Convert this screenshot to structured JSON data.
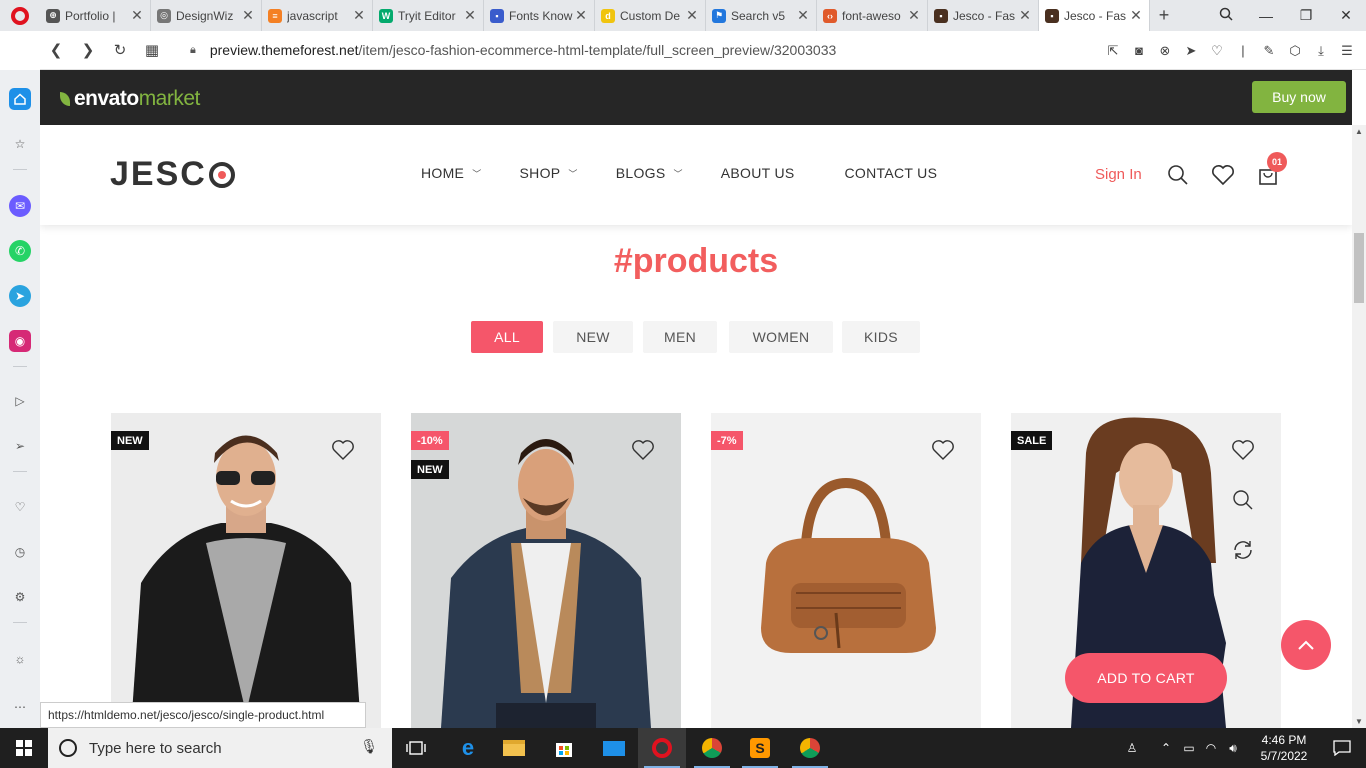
{
  "browser": {
    "tabs": [
      {
        "label": "Portfolio |",
        "color": "#555555",
        "glyph": "⊕"
      },
      {
        "label": "DesignWiz",
        "color": "#777777",
        "glyph": "◎"
      },
      {
        "label": "javascript",
        "color": "#f48024",
        "glyph": "≡"
      },
      {
        "label": "Tryit Editor",
        "color": "#04aa6d",
        "glyph": "W"
      },
      {
        "label": "Fonts Know",
        "color": "#3a5ccc",
        "glyph": "▪"
      },
      {
        "label": "Custom De",
        "color": "#f0c40f",
        "glyph": "d"
      },
      {
        "label": "Search v5",
        "color": "#2277dd",
        "glyph": "⚑"
      },
      {
        "label": "font-aweso",
        "color": "#e05a2b",
        "glyph": "‹›"
      },
      {
        "label": "Jesco - Fas",
        "color": "#4a3020",
        "glyph": "▪"
      },
      {
        "label": "Jesco - Fas",
        "color": "#4a3020",
        "glyph": "▪",
        "active": true
      }
    ],
    "new_tab": "+",
    "url_host": "preview.themeforest.net",
    "url_path": "/item/jesco-fashion-ecommerce-html-template/full_screen_preview/32003033",
    "status_url": "https://htmldemo.net/jesco/jesco/single-product.html"
  },
  "envato": {
    "logo_main": "envato",
    "logo_sub": "market",
    "buy_now": "Buy now",
    "brand_color": "#82b440"
  },
  "site": {
    "brand": "JESC",
    "menu": [
      {
        "label": "HOME",
        "chevron": true
      },
      {
        "label": "SHOP",
        "chevron": true
      },
      {
        "label": "BLOGS",
        "chevron": true
      },
      {
        "label": "ABOUT US",
        "chevron": false
      },
      {
        "label": "CONTACT US",
        "chevron": false
      }
    ],
    "sign_in": "Sign In",
    "cart_count": "01",
    "accent": "#f5566a"
  },
  "products": {
    "title": "#products",
    "filters": [
      "ALL",
      "NEW",
      "MEN",
      "WOMEN",
      "KIDS"
    ],
    "active_filter": "ALL",
    "cards": [
      {
        "badges": [
          {
            "text": "NEW",
            "style": "dark"
          }
        ],
        "image": "man-leather-jacket"
      },
      {
        "badges": [
          {
            "text": "-10%",
            "style": "red"
          },
          {
            "text": "NEW",
            "style": "dark"
          }
        ],
        "image": "man-denim-jacket"
      },
      {
        "badges": [
          {
            "text": "-7%",
            "style": "red"
          }
        ],
        "image": "brown-leather-bag"
      },
      {
        "badges": [
          {
            "text": "SALE",
            "style": "dark"
          }
        ],
        "image": "woman-navy-dress"
      }
    ],
    "add_to_cart": "ADD TO CART"
  },
  "taskbar": {
    "search_placeholder": "Type here to search",
    "time": "4:46 PM",
    "date": "5/7/2022"
  }
}
